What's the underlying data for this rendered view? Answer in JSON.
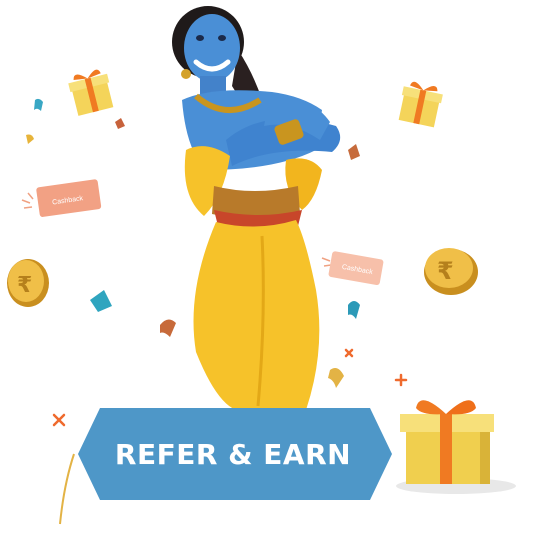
{
  "banner": {
    "label": "REFER & EARN"
  },
  "tickets": [
    {
      "label": "Cashback"
    },
    {
      "label": "Cashback"
    }
  ],
  "colors": {
    "banner_blue": "#4e97c8",
    "gift_yellow": "#f4d45a",
    "ribbon_orange": "#f07a22",
    "coin_gold": "#e9b43a",
    "ticket_salmon": "#f2a184",
    "outfit_yellow": "#f6c22a",
    "skin_blue": "#4a8fd6"
  },
  "icons": [
    "gift-box-icon",
    "rupee-coin-icon",
    "cashback-ticket-icon",
    "confetti-icon",
    "sparkle-icon"
  ]
}
